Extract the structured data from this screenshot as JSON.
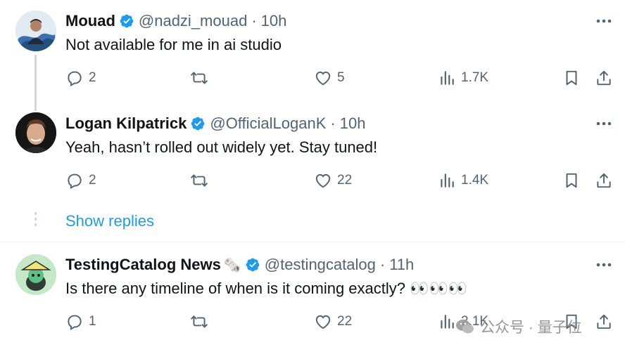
{
  "tweets": [
    {
      "name": "Mouad",
      "handle": "@nadzi_mouad",
      "separator": "·",
      "time": "10h",
      "text": "Not available for me in ai studio",
      "replies": "2",
      "likes": "5",
      "views": "1.7K"
    },
    {
      "name": "Logan Kilpatrick",
      "handle": "@OfficialLoganK",
      "separator": "·",
      "time": "10h",
      "text": "Yeah, hasn’t rolled out widely yet. Stay tuned!",
      "replies": "2",
      "likes": "22",
      "views": "1.4K"
    },
    {
      "name": "TestingCatalog News",
      "handle": "@testingcatalog",
      "separator": "·",
      "time": "11h",
      "text": "Is there any timeline of when is it coming exactly? 👀👀👀",
      "replies": "1",
      "likes": "22",
      "views": "2.1K",
      "name_emoji": "🗞️"
    }
  ],
  "show_replies_label": "Show replies",
  "watermark_text": "公众号 · 量子位",
  "colors": {
    "text": "#0f1419",
    "secondary": "#536471",
    "link": "#1d9bf0",
    "verified": "#1d9bf0",
    "thread_line": "#cfd9de"
  },
  "icons": [
    "more-icon",
    "reply-icon",
    "retweet-icon",
    "like-icon",
    "views-icon",
    "bookmark-icon",
    "share-icon",
    "verified-icon"
  ]
}
